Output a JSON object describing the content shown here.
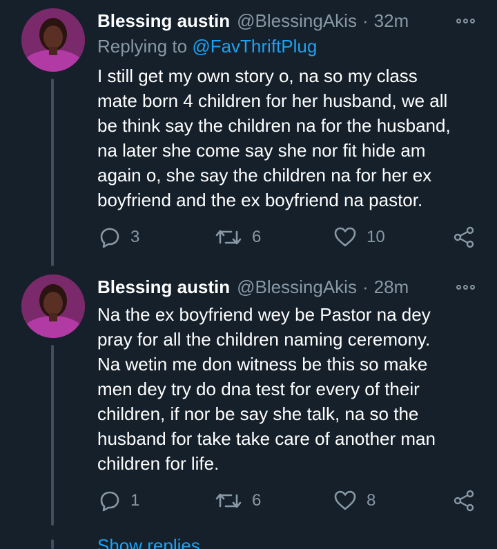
{
  "tweets": [
    {
      "name": "Blessing austin",
      "handle": "@BlessingAkis",
      "separator": "·",
      "time": "32m",
      "replying_label": "Replying to",
      "replying_to": "@FavThriftPlug",
      "lines": [
        "I still get my own story o, na so my class",
        "mate born 4 children for her husband, we all",
        "be think say the children na for the husband,",
        "na later she come say she nor fit hide am",
        "again o, she say the children na for her ex",
        "boyfriend and the ex boyfriend na pastor."
      ],
      "replies": "3",
      "retweets": "6",
      "likes": "10"
    },
    {
      "name": "Blessing austin",
      "handle": "@BlessingAkis",
      "separator": "·",
      "time": "28m",
      "lines": [
        "Na the ex boyfriend wey be Pastor na dey",
        "pray for all the children naming ceremony.",
        "Na wetin me don witness be this so make",
        "men dey try do dna test for every of their",
        "children, if nor be say she talk, na so the",
        "husband for take take care of another man",
        "children for life."
      ],
      "replies": "1",
      "retweets": "6",
      "likes": "8"
    }
  ],
  "show_replies": "Show replies",
  "icons": {
    "reply": "reply-icon",
    "retweet": "retweet-icon",
    "like": "heart-icon",
    "share": "share-icon",
    "more": "more-options-icon"
  },
  "colors": {
    "background": "#15202b",
    "text": "#ffffff",
    "secondary": "#8899a6",
    "accent": "#1da1f2",
    "thread_line": "#3d4e5e"
  }
}
